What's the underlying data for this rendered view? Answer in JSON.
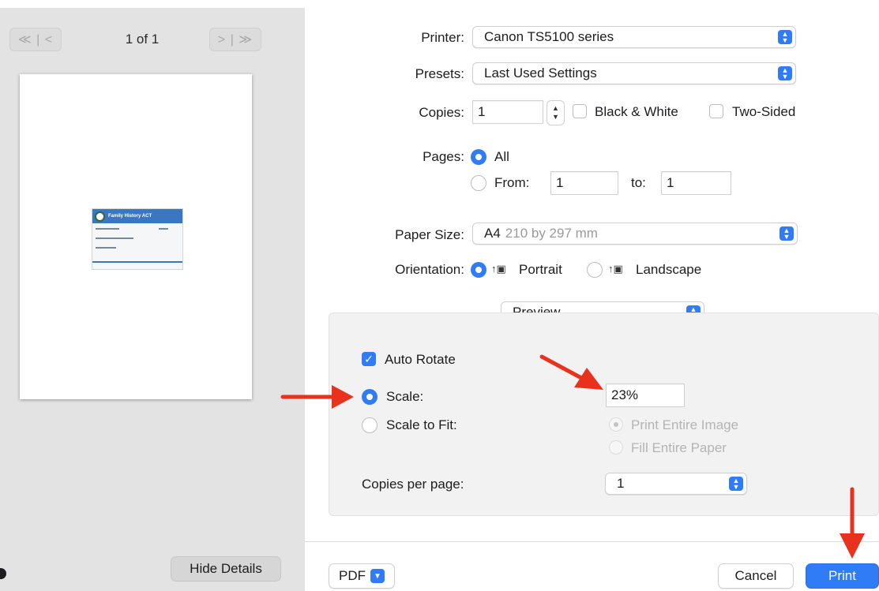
{
  "preview": {
    "page_indicator": "1 of 1",
    "first_prev_glyph": "≪ | <",
    "next_last_glyph": "> | ≫",
    "card_title": "Family History ACT",
    "hide_details_label": "Hide Details"
  },
  "printer": {
    "label": "Printer:",
    "value": "Canon TS5100 series"
  },
  "presets": {
    "label": "Presets:",
    "value": "Last Used Settings"
  },
  "copies": {
    "label": "Copies:",
    "value": "1",
    "bw_label": "Black & White",
    "two_sided_label": "Two-Sided"
  },
  "pages": {
    "label": "Pages:",
    "all_label": "All",
    "from_label": "From:",
    "from_value": "1",
    "to_label": "to:",
    "to_value": "1"
  },
  "paper_size": {
    "label": "Paper Size:",
    "value": "A4",
    "detail": "210 by 297 mm"
  },
  "orientation": {
    "label": "Orientation:",
    "portrait_label": "Portrait",
    "landscape_label": "Landscape"
  },
  "section": {
    "value": "Preview"
  },
  "preview_options": {
    "auto_rotate_label": "Auto Rotate",
    "scale_label": "Scale:",
    "scale_value": "23%",
    "scale_to_fit_label": "Scale to Fit:",
    "print_entire_image_label": "Print Entire Image",
    "fill_entire_paper_label": "Fill Entire Paper",
    "copies_per_page_label": "Copies per page:",
    "copies_per_page_value": "1"
  },
  "footer": {
    "pdf_label": "PDF",
    "cancel_label": "Cancel",
    "print_label": "Print"
  },
  "colors": {
    "accent": "#2f7cf6",
    "annotation_arrow": "#e8321e"
  }
}
